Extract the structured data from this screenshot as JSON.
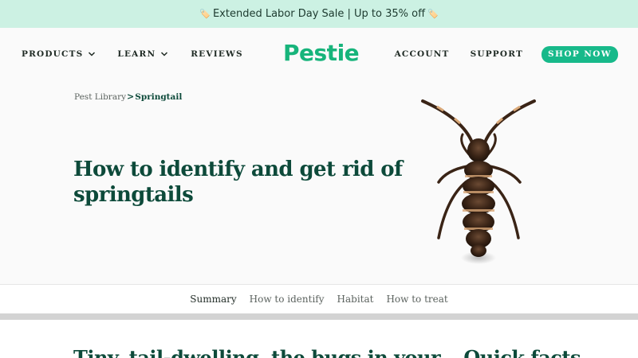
{
  "promo": {
    "emoji": "🏷️",
    "text": "Extended Labor Day Sale | Up to 35% off"
  },
  "header": {
    "nav_left": [
      "PRODUCTS",
      "LEARN",
      "REVIEWS"
    ],
    "logo": "Pestie",
    "account": "ACCOUNT",
    "support": "SUPPORT",
    "shop_now": "SHOP NOW",
    "colors": {
      "brand": "#17b47b",
      "button": "#17b98a",
      "promo_bg": "#ccf1e3"
    }
  },
  "breadcrumb": {
    "parent": "Pest Library",
    "separator": ">",
    "current": "Springtail"
  },
  "hero": {
    "title": "How to identify and get rid of springtails",
    "image_icon": "springtail-illustration"
  },
  "tabs": [
    "Summary",
    "How to identify",
    "Habitat",
    "How to treat"
  ],
  "active_tab": "Summary",
  "sections": {
    "next_heading_partial": "Tiny, tail-dwelling, the bugs in your... Quick facts"
  }
}
